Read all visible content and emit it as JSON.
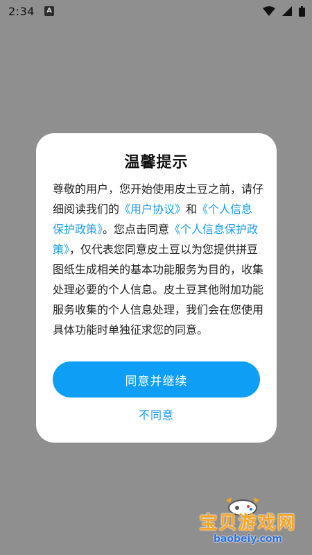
{
  "status_bar": {
    "time": "2:34",
    "notification_badge": "A"
  },
  "dialog": {
    "title": "温馨提示",
    "body": {
      "p1": "尊敬的用户，您开始使用皮土豆之前，请仔细阅读我们的",
      "link1": "《用户协议》",
      "p2": "和",
      "link2": "《个人信息保护政策》",
      "p3": "。您点击同意",
      "link3": "《个人信息保护政策》",
      "p4": "，仅代表您同意皮土豆以为您提供拼豆图纸生成相关的基本功能服务为目的，收集处理必要的个人信息。皮土豆其他附加功能服务收集的个人信息处理，我们会在您使用具体功能时单独征求您的同意。"
    },
    "agree_label": "同意并继续",
    "disagree_label": "不同意"
  },
  "watermark": {
    "text": "宝贝游戏网",
    "url": "baobeiy.com"
  },
  "colors": {
    "accent": "#0e9ef6",
    "link": "#1a9bf0",
    "overlay": "#8f8f8f"
  }
}
